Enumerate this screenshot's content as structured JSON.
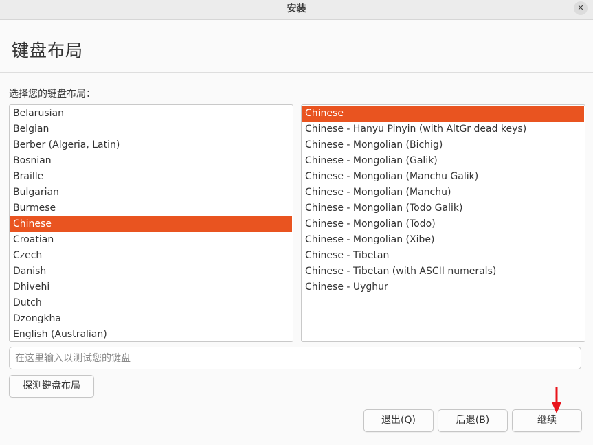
{
  "window": {
    "title": "安装",
    "close_glyph": "✕"
  },
  "header": {
    "title": "键盘布局"
  },
  "prompt": "选择您的键盘布局：",
  "layouts": {
    "items": [
      "Belarusian",
      "Belgian",
      "Berber (Algeria, Latin)",
      "Bosnian",
      "Braille",
      "Bulgarian",
      "Burmese",
      "Chinese",
      "Croatian",
      "Czech",
      "Danish",
      "Dhivehi",
      "Dutch",
      "Dzongkha",
      "English (Australian)"
    ],
    "selected": "Chinese"
  },
  "variants": {
    "items": [
      "Chinese",
      "Chinese - Hanyu Pinyin (with AltGr dead keys)",
      "Chinese - Mongolian (Bichig)",
      "Chinese - Mongolian (Galik)",
      "Chinese - Mongolian (Manchu Galik)",
      "Chinese - Mongolian (Manchu)",
      "Chinese - Mongolian (Todo Galik)",
      "Chinese - Mongolian (Todo)",
      "Chinese - Mongolian (Xibe)",
      "Chinese - Tibetan",
      "Chinese - Tibetan (with ASCII numerals)",
      "Chinese - Uyghur"
    ],
    "selected": "Chinese"
  },
  "test_input": {
    "placeholder": "在这里输入以测试您的键盘",
    "value": ""
  },
  "buttons": {
    "detect": "探测键盘布局",
    "quit": "退出(Q)",
    "back": "后退(B)",
    "continue": "继续"
  },
  "colors": {
    "selection": "#e95420",
    "annotation_arrow": "#e8141b"
  }
}
